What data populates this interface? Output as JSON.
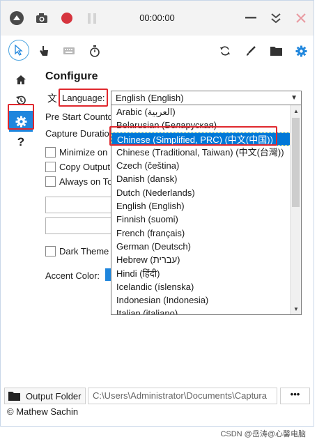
{
  "titlebar": {
    "timer": "00:00:00",
    "icons": [
      "collapse-icon",
      "camera-icon",
      "record-icon",
      "pause-icon",
      "minimize-icon",
      "collapse-down-icon",
      "close-icon"
    ]
  },
  "toolbar": {
    "icons": [
      "cursor-icon",
      "hand-icon",
      "keyboard-icon",
      "stopwatch-icon",
      "refresh-icon",
      "brush-icon",
      "folder-icon",
      "settings-icon"
    ]
  },
  "sidebar": {
    "items": [
      "home-icon",
      "history-icon",
      "settings-icon",
      "help-icon"
    ]
  },
  "main": {
    "title": "Configure",
    "language_label": "Language:",
    "language_value": "English (English)",
    "pre_start": "Pre Start Countd",
    "capture_duration": "Capture Duratio",
    "minimize_on": "Minimize on",
    "copy_output": "Copy Output",
    "always_on_top": "Always on To",
    "dark_theme": "Dark Theme",
    "accent_color": "Accent Color:"
  },
  "languages": [
    "Arabic (العربية)",
    "Belarusian (Беларуская)",
    "Chinese (Simplified, PRC) (中文(中国))",
    "Chinese (Traditional, Taiwan) (中文(台灣))",
    "Czech (čeština)",
    "Danish (dansk)",
    "Dutch (Nederlands)",
    "English (English)",
    "Finnish (suomi)",
    "French (français)",
    "German (Deutsch)",
    "Hebrew (עברית)",
    "Hindi (हिंदी)",
    "Icelandic (íslenska)",
    "Indonesian (Indonesia)",
    "Italian (italiano)"
  ],
  "bottom": {
    "output_folder_label": "Output Folder",
    "output_path": "C:\\Users\\Administrator\\Documents\\Captura",
    "more_label": "•••",
    "footer": "© Mathew Sachin"
  },
  "watermark": "CSDN @岳涛@心馨电脑",
  "colors": {
    "accent": "#1f86dd",
    "selection": "#0078d7",
    "highlight_box": "#e0282e",
    "record": "#d6343e"
  }
}
